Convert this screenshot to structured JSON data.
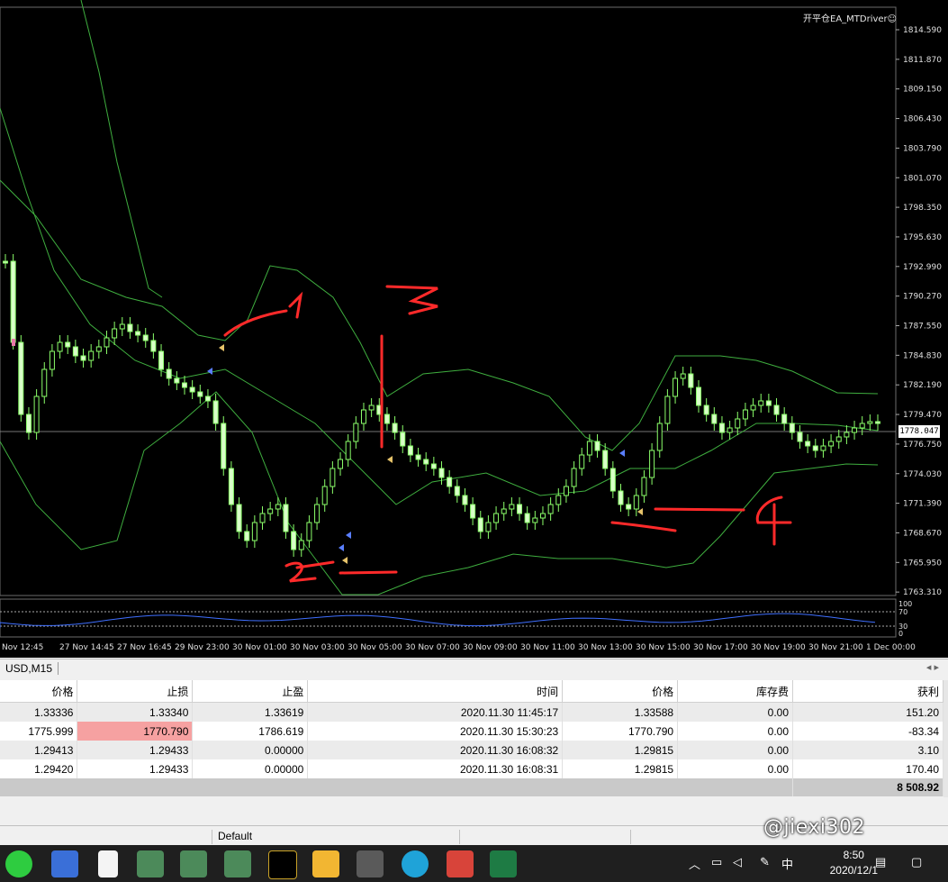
{
  "chart": {
    "symbol_tab": "USD,M15",
    "ea_label": "开平仓EA_MTDriver☺",
    "current_price": "1778.047",
    "price_ticks": [
      "1814.590",
      "1811.870",
      "1809.150",
      "1806.430",
      "1803.790",
      "1801.070",
      "1798.350",
      "1795.630",
      "1792.990",
      "1790.270",
      "1787.550",
      "1784.830",
      "1782.190",
      "1779.470",
      "1776.750",
      "1774.030",
      "1771.390",
      "1768.670",
      "1765.950",
      "1763.310"
    ],
    "time_ticks": [
      "Nov 12:45",
      "27 Nov 14:45",
      "27 Nov 16:45",
      "29 Nov 23:00",
      "30 Nov 01:00",
      "30 Nov 03:00",
      "30 Nov 05:00",
      "30 Nov 07:00",
      "30 Nov 09:00",
      "30 Nov 11:00",
      "30 Nov 13:00",
      "30 Nov 15:00",
      "30 Nov 17:00",
      "30 Nov 19:00",
      "30 Nov 21:00",
      "1 Dec 00:00"
    ],
    "indicator_levels": [
      "100",
      "70",
      "30",
      "0"
    ],
    "annotations": [
      "1",
      "2",
      "3",
      "4"
    ],
    "colors": {
      "background": "#000000",
      "candle": "#8bff6a",
      "bands": "#3fae3f",
      "annotation": "#ff2a2a",
      "indicator": "#3f6fff"
    }
  },
  "orders": {
    "headers": [
      "价格",
      "止损",
      "止盈",
      "时间",
      "价格",
      "库存费",
      "获利"
    ],
    "rows": [
      [
        "1.33336",
        "1.33340",
        "1.33619",
        "2020.11.30 11:45:17",
        "1.33588",
        "0.00",
        "151.20"
      ],
      [
        "1775.999",
        "1770.790",
        "1786.619",
        "2020.11.30 15:30:23",
        "1770.790",
        "0.00",
        "-83.34"
      ],
      [
        "1.29413",
        "1.29433",
        "0.00000",
        "2020.11.30 16:08:32",
        "1.29815",
        "0.00",
        "3.10"
      ],
      [
        "1.29420",
        "1.29433",
        "0.00000",
        "2020.11.30 16:08:31",
        "1.29815",
        "0.00",
        "170.40"
      ]
    ],
    "total": "8 508.92"
  },
  "statusbar": {
    "profile": "Default"
  },
  "taskbar": {
    "time": "8:50",
    "date": "2020/12/1",
    "ime": "中",
    "icons": [
      "wechat-icon",
      "monitor-icon",
      "file-icon",
      "terminal-1-icon",
      "terminal-2-icon",
      "terminal-3-icon",
      "broker-icon",
      "folder-icon",
      "calculator-icon",
      "edge-icon",
      "media-icon",
      "excel-icon"
    ]
  },
  "watermark": "@jiexi302"
}
